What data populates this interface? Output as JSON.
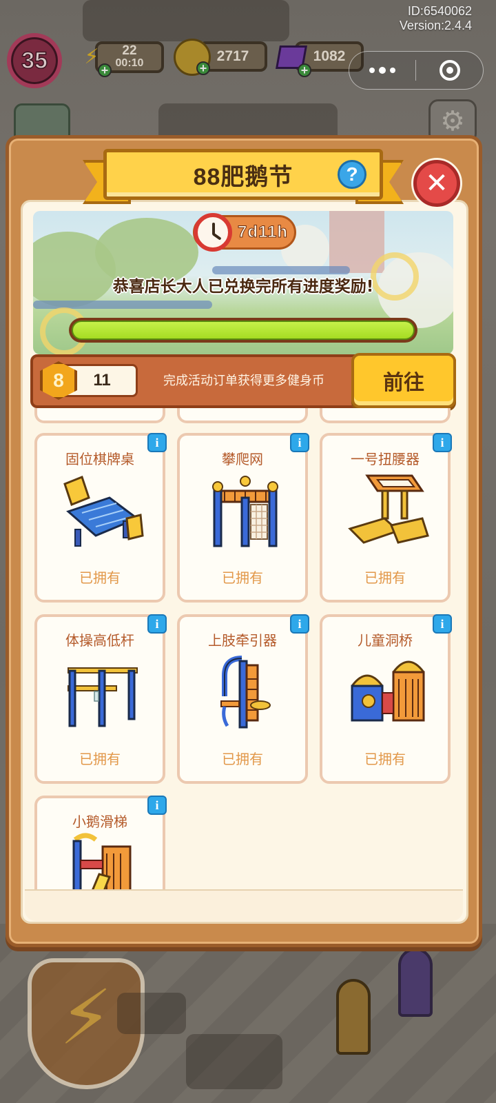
{
  "status_bar": {
    "user_id": "ID:6540062",
    "version": "Version:2.4.4"
  },
  "player": {
    "level": "35",
    "energy": "22",
    "energy_timer": "00:10",
    "coins": "2717",
    "gems": "1082"
  },
  "modal": {
    "title": "88肥鹅节",
    "countdown": "7d11h",
    "congrats_text": "恭喜店长大人已兑换完所有进度奖励!",
    "progress": 1.0,
    "token_count": "11",
    "token_icon_label": "8",
    "hint_text": "完成活动订单获得更多健身币",
    "go_button": "前往"
  },
  "items": [
    {
      "name": "固位棋牌桌",
      "status": "已拥有",
      "art": "card-table"
    },
    {
      "name": "攀爬网",
      "status": "已拥有",
      "art": "climbing-net"
    },
    {
      "name": "一号扭腰器",
      "status": "已拥有",
      "art": "waist-twister"
    },
    {
      "name": "体操高低杆",
      "status": "已拥有",
      "art": "parallel-bars"
    },
    {
      "name": "上肢牵引器",
      "status": "已拥有",
      "art": "arm-puller"
    },
    {
      "name": "儿童洞桥",
      "status": "已拥有",
      "art": "kids-tunnel-bridge"
    },
    {
      "name": "小鹅滑梯",
      "status": "",
      "art": "goose-slide"
    }
  ],
  "colors": {
    "accent_orange": "#c98a4c",
    "title_yellow": "#ffd24a",
    "progress_green": "#a6dc22",
    "close_red": "#e44a48",
    "info_blue": "#2ea8ea",
    "owned_text": "#e2984a"
  },
  "icons": [
    "lightning-icon",
    "coin-icon",
    "gem-icon",
    "more-dots-icon",
    "target-icon",
    "gear-icon",
    "help-icon",
    "close-icon",
    "clock-icon",
    "fitness-coin-icon",
    "info-icon"
  ]
}
